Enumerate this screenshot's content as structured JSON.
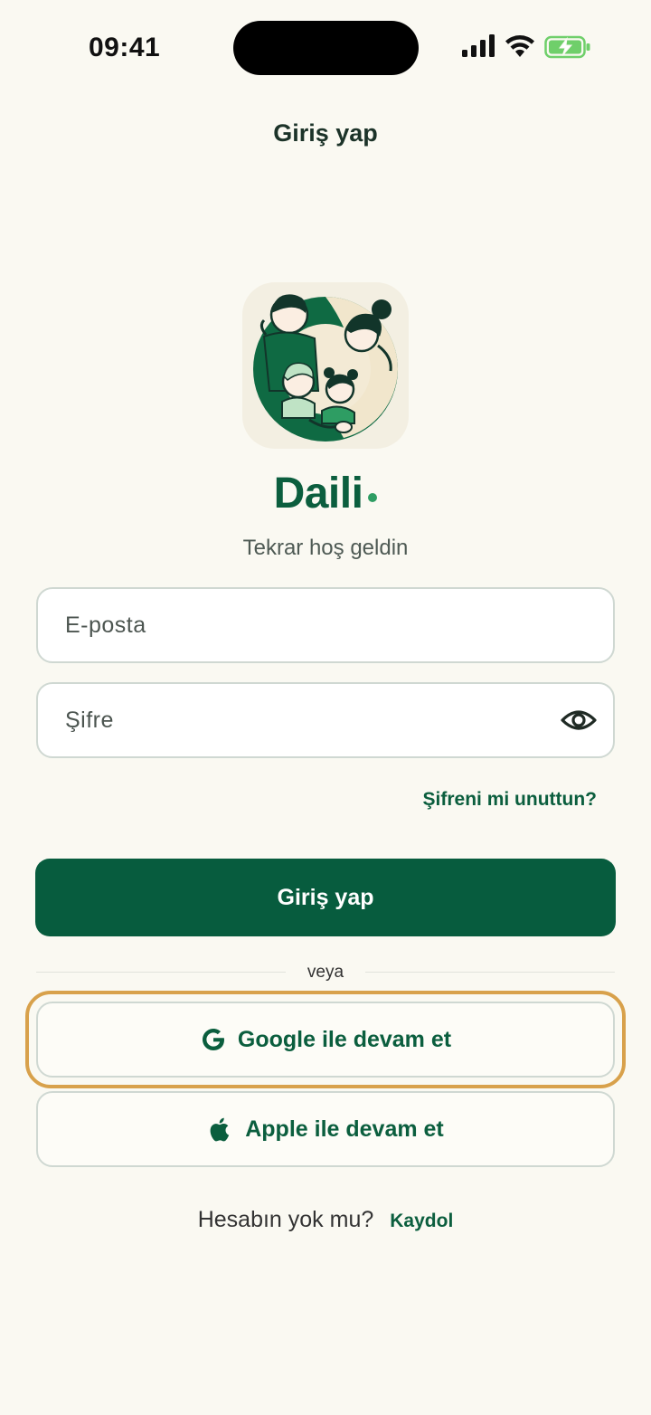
{
  "status_bar": {
    "time": "09:41",
    "icons": [
      "signal-icon",
      "wifi-icon",
      "battery-charging-icon"
    ]
  },
  "nav": {
    "title": "Giriş yap"
  },
  "brand": {
    "name": "Daili",
    "tagline": "Tekrar hoş geldin",
    "logo_icon": "family-illustration-logo",
    "primary_color": "#075c3e",
    "accent_color": "#2e9d63"
  },
  "form": {
    "email_placeholder": "E-posta",
    "password_placeholder": "Şifre",
    "forgot_password": "Şifreni mi unuttun?",
    "submit_label": "Giriş yap"
  },
  "divider": {
    "label": "veya"
  },
  "social": {
    "google_label": "Google ile devam et",
    "apple_label": "Apple ile devam et",
    "focus_color": "#d8a14b"
  },
  "signup": {
    "prompt": "Hesabın yok mu?",
    "link": "Kaydol"
  }
}
